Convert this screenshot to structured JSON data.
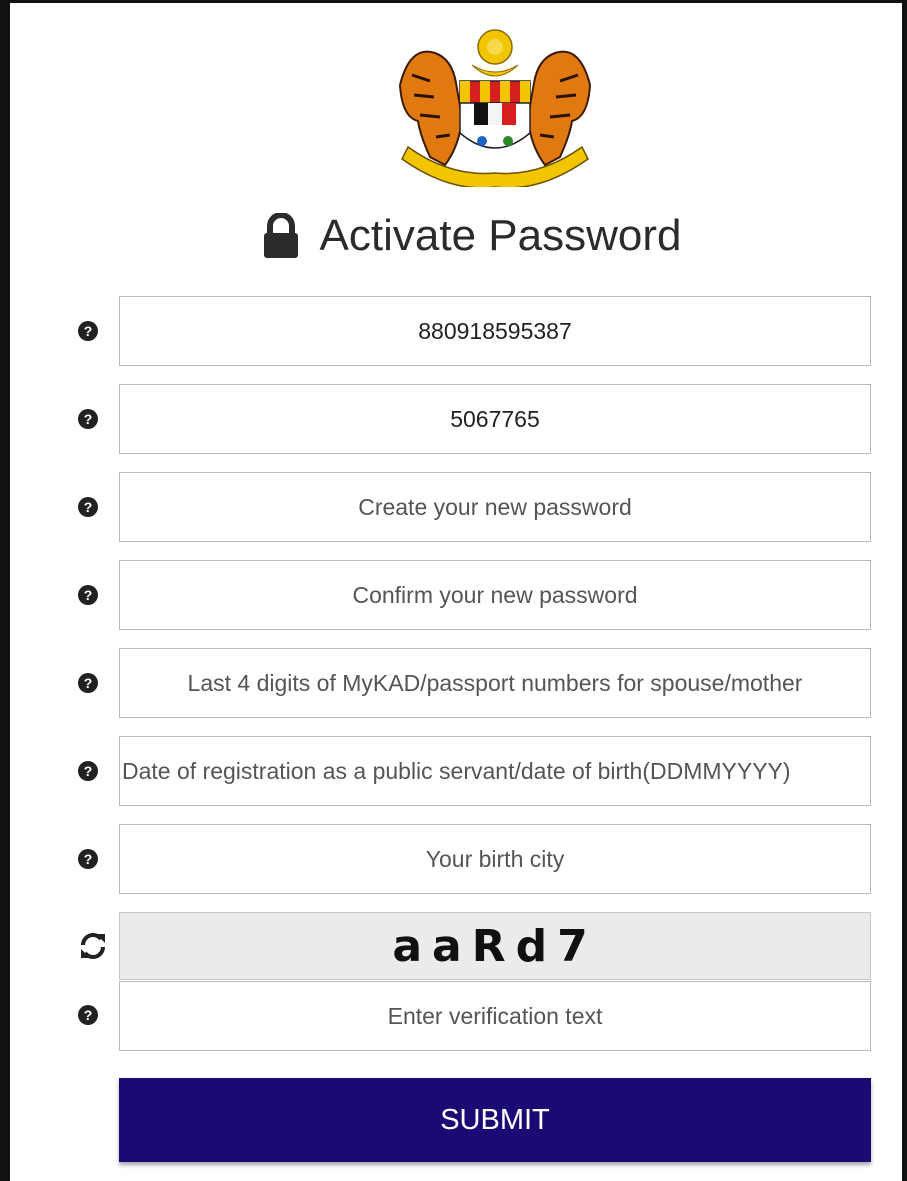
{
  "page": {
    "title": "Activate Password"
  },
  "fields": [
    {
      "value": "880918595387",
      "placeholder": ""
    },
    {
      "value": "5067765",
      "placeholder": ""
    },
    {
      "value": "",
      "placeholder": "Create your new password"
    },
    {
      "value": "",
      "placeholder": "Confirm your new password"
    },
    {
      "value": "",
      "placeholder": "Last 4 digits of MyKAD/passport numbers for spouse/mother"
    },
    {
      "value": "",
      "placeholder": "Date of registration as a public servant/date of birth(DDMMYYYY)"
    },
    {
      "value": "",
      "placeholder": "Your birth city"
    }
  ],
  "captcha": {
    "text": "aaRd7"
  },
  "verification": {
    "value": "",
    "placeholder": "Enter verification text"
  },
  "submit": {
    "label": "SUBMIT"
  },
  "icons": {
    "logo": "malaysia-coat-of-arms-icon",
    "heading": "lock-icon",
    "help": "question-circle-icon",
    "refresh": "refresh-icon"
  },
  "colors": {
    "submit_bg": "#1a0a73",
    "captcha_bg": "#ebebeb"
  }
}
